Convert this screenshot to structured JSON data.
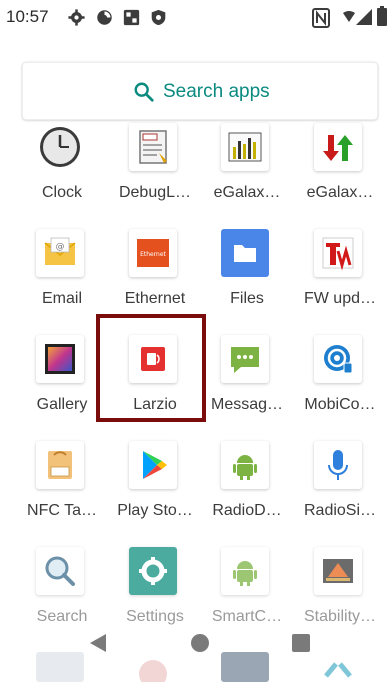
{
  "status_bar": {
    "time": "10:57",
    "icons": [
      "settings-icon",
      "data-saver-icon",
      "screenshot-icon",
      "shield-icon",
      "nfc-icon",
      "wifi-icon",
      "signal-icon",
      "battery-icon"
    ]
  },
  "search": {
    "label": "Search apps",
    "accent": "#0b8a80"
  },
  "apps": [
    {
      "label": "Clock",
      "icon": "clock-icon"
    },
    {
      "label": "DebugL…",
      "icon": "debug-log-icon"
    },
    {
      "label": "eGalax…",
      "icon": "egalax-chart-icon"
    },
    {
      "label": "eGalax…",
      "icon": "egalax-arrows-icon"
    },
    {
      "label": "Email",
      "icon": "email-icon"
    },
    {
      "label": "Ethernet",
      "icon": "ethernet-icon"
    },
    {
      "label": "Files",
      "icon": "folder-icon"
    },
    {
      "label": "FW upd…",
      "icon": "fw-update-icon"
    },
    {
      "label": "Gallery",
      "icon": "gallery-icon"
    },
    {
      "label": "Larzio",
      "icon": "larzio-icon"
    },
    {
      "label": "Messag…",
      "icon": "messages-icon"
    },
    {
      "label": "MobiCo…",
      "icon": "mobicontrol-icon"
    },
    {
      "label": "NFC Ta…",
      "icon": "nfc-tag-icon"
    },
    {
      "label": "Play Sto…",
      "icon": "play-store-icon"
    },
    {
      "label": "RadioD…",
      "icon": "android-icon"
    },
    {
      "label": "RadioSi…",
      "icon": "microphone-icon"
    },
    {
      "label": "Search",
      "icon": "magnifier-icon"
    },
    {
      "label": "Settings",
      "icon": "gear-icon"
    },
    {
      "label": "SmartC…",
      "icon": "android-icon"
    },
    {
      "label": "Stability…",
      "icon": "stability-icon"
    }
  ],
  "ethernet_icon_text": "Ethernet",
  "highlight_color": "#7b0c0c",
  "nav": [
    "back-icon",
    "home-icon",
    "recents-icon"
  ]
}
